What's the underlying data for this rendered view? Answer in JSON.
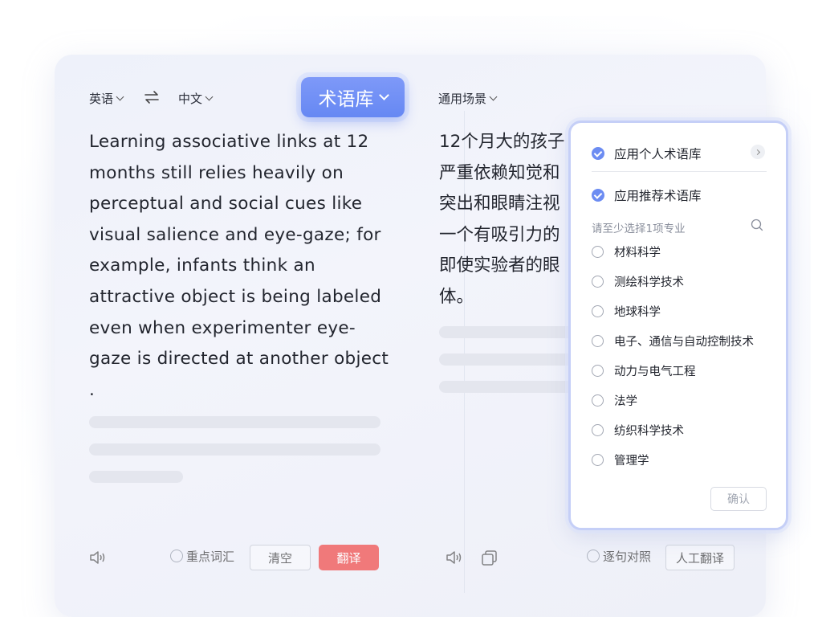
{
  "source": {
    "lang_from": "英语",
    "lang_to": "中文",
    "text": "Learning associative links at 12 months still relies heavily on perceptual and social cues like visual salience and eye-gaze; for example, infants think an attractive object is being labeled even when experimenter eye-gaze is directed at another object ."
  },
  "term_library": {
    "label": "术语库"
  },
  "target": {
    "scene": "通用场景",
    "lines": [
      "12个月大的孩子",
      "严重依赖知觉和",
      "突出和眼睛注视",
      "一个有吸引力的",
      "即使实验者的眼",
      "体。"
    ]
  },
  "bottom_left": {
    "highlight_label": "重点词汇",
    "clear_label": "清空",
    "translate_label": "翻译"
  },
  "bottom_right": {
    "compare_label": "逐句对照",
    "human_label": "人工翻译"
  },
  "panel": {
    "personal_label": "应用个人术语库",
    "recommended_label": "应用推荐术语库",
    "hint": "请至少选择1项专业",
    "options": [
      "材料科学",
      "测绘科学技术",
      "地球科学",
      "电子、通信与自动控制技术",
      "动力与电气工程",
      "法学",
      "纺织科学技术",
      "管理学"
    ],
    "confirm_label": "确认"
  },
  "colors": {
    "accent": "#6c8cf2",
    "translate_button": "#f06565"
  },
  "icons": [
    "swap-icon",
    "chevron-down-icon",
    "speaker-icon",
    "copy-icon",
    "check-icon",
    "chevron-right-icon",
    "search-icon"
  ]
}
